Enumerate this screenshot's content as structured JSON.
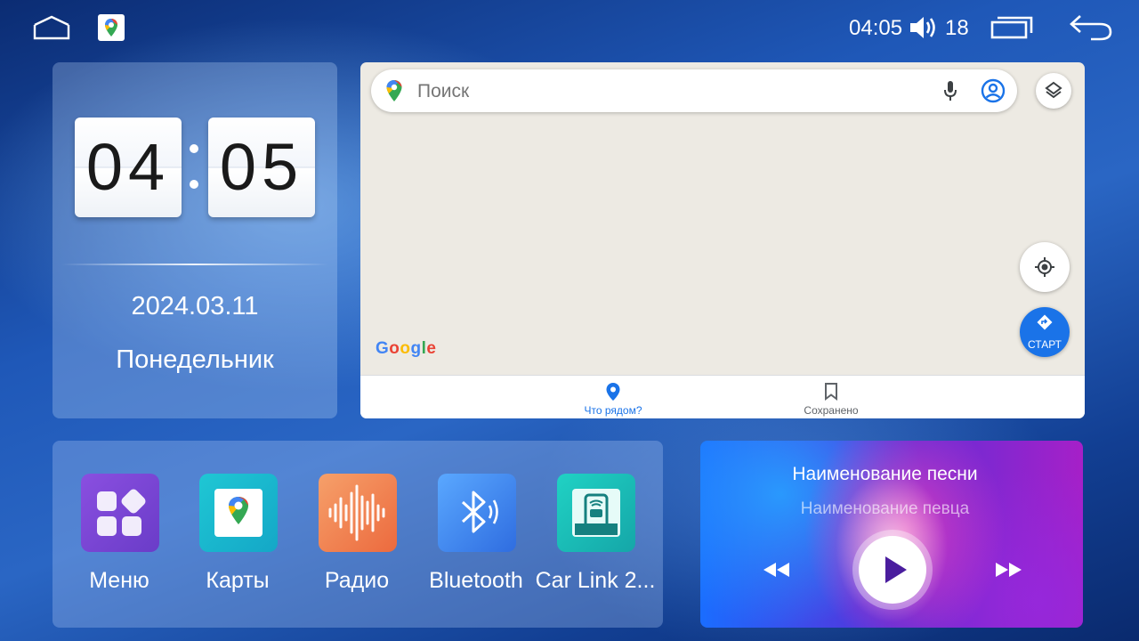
{
  "status_bar": {
    "time": "04:05",
    "volume": "18",
    "icons": [
      "home-icon",
      "google-maps-icon",
      "volume-icon",
      "recents-icon",
      "back-icon"
    ]
  },
  "clock": {
    "hours": "04",
    "minutes": "05",
    "date": "2024.03.11",
    "weekday": "Понедельник"
  },
  "map": {
    "search_placeholder": "Поиск",
    "google_logo": "Google",
    "start_label": "СТАРТ",
    "tabs": [
      {
        "label": "Что рядом?",
        "icon": "location-pin-icon",
        "active": true
      },
      {
        "label": "Сохранено",
        "icon": "bookmark-icon",
        "active": false
      }
    ],
    "accent": "#1a73e8",
    "background": "#edeae3"
  },
  "apps": [
    {
      "label": "Меню",
      "icon": "menu-grid-icon"
    },
    {
      "label": "Карты",
      "icon": "google-maps-icon"
    },
    {
      "label": "Радио",
      "icon": "radio-wave-icon"
    },
    {
      "label": "Bluetooth",
      "icon": "bluetooth-icon"
    },
    {
      "label": "Car Link 2...",
      "icon": "car-link-icon"
    }
  ],
  "music": {
    "song_title": "Наименование песни",
    "artist": "Наименование певца",
    "controls": [
      "previous-icon",
      "play-icon",
      "next-icon"
    ]
  }
}
